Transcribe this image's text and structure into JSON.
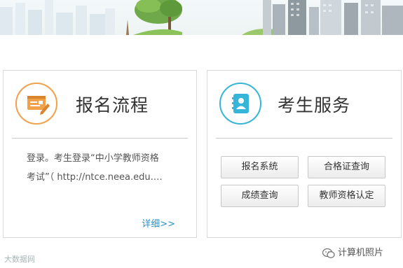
{
  "panels": {
    "registration": {
      "title": "报名流程",
      "desc_line1": "登录。考生登录“中小学教师资格",
      "desc_line2": "考试”（ http://ntce.neea.edu.…",
      "more_label": "详细>>"
    },
    "services": {
      "title": "考生服务",
      "buttons": [
        "报名系统",
        "合格证查询",
        "成绩查询",
        "教师资格认定"
      ]
    }
  },
  "watermarks": {
    "left": "大数据网",
    "right": "计算机照片"
  },
  "colors": {
    "orange_accent": "#f0a14a",
    "blue_accent": "#37b5d8",
    "link": "#2a8fc7"
  },
  "icons": [
    "banner-skyline",
    "registration-form-icon",
    "contact-book-icon",
    "wechat-icon"
  ]
}
